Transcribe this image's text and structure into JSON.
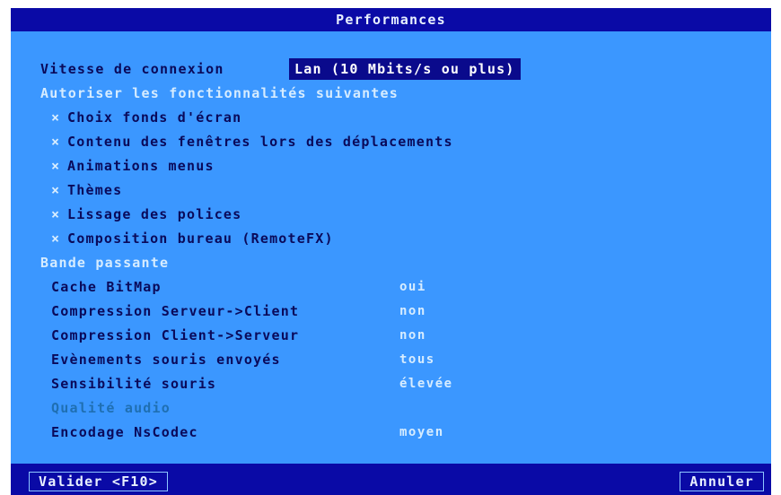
{
  "dialog": {
    "title": "Performances"
  },
  "connection": {
    "label": "Vitesse de connexion",
    "value": "Lan (10 Mbits/s ou plus)"
  },
  "features": {
    "heading": "Autoriser les fonctionnalités suivantes",
    "items": [
      {
        "label": "Choix fonds d'écran",
        "mark": "×"
      },
      {
        "label": "Contenu des fenêtres lors des déplacements",
        "mark": "×"
      },
      {
        "label": "Animations menus",
        "mark": "×"
      },
      {
        "label": "Thèmes",
        "mark": "×"
      },
      {
        "label": "Lissage des polices",
        "mark": "×"
      },
      {
        "label": "Composition bureau (RemoteFX)",
        "mark": "×"
      }
    ]
  },
  "bandwidth": {
    "heading": "Bande passante",
    "rows": [
      {
        "label": "Cache BitMap",
        "value": "oui"
      },
      {
        "label": "Compression Serveur->Client",
        "value": "non"
      },
      {
        "label": "Compression Client->Serveur",
        "value": "non"
      },
      {
        "label": "Evènements souris envoyés",
        "value": "tous"
      },
      {
        "label": "Sensibilité souris",
        "value": "élevée"
      },
      {
        "label": "Qualité audio",
        "value": ""
      },
      {
        "label": "Encodage NsCodec",
        "value": "moyen"
      }
    ]
  },
  "buttons": {
    "validate": "Valider <F10>",
    "cancel": "Annuler"
  },
  "colors": {
    "background": "#3b97ff",
    "title_bar": "#0a0aa6",
    "dark_text": "#0a0a5a",
    "light_text": "#d6ecff",
    "disabled_text": "#1f6fb2",
    "selection": "#0a0a8c"
  }
}
